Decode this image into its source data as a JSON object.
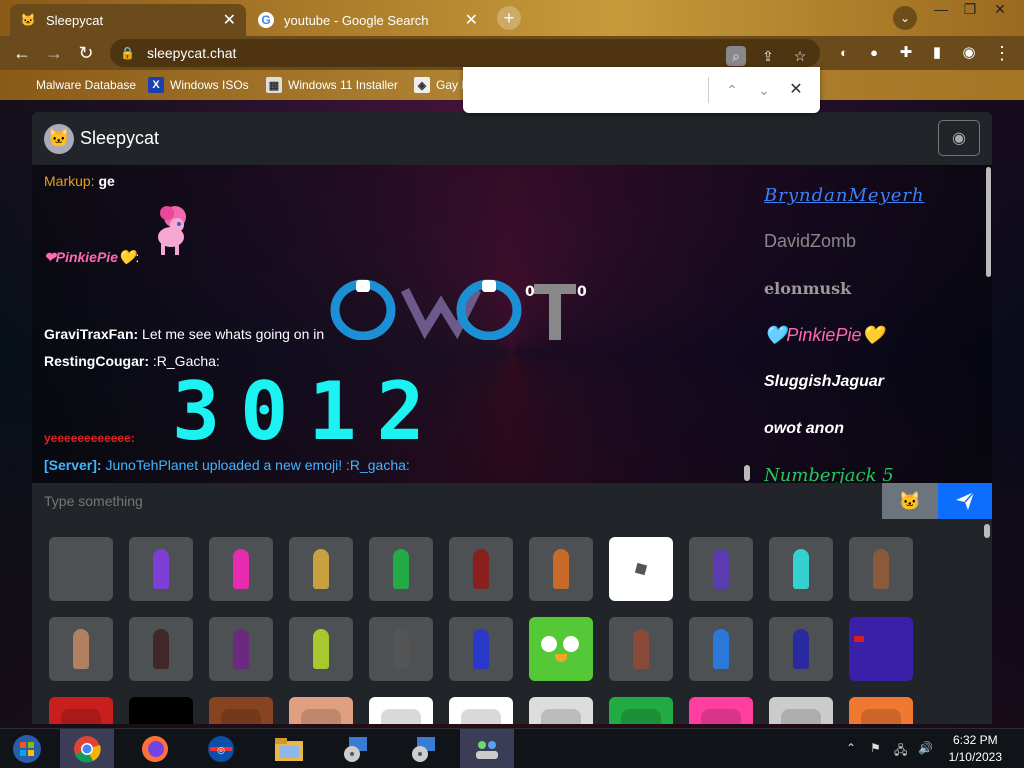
{
  "browser": {
    "tabs": [
      {
        "title": "Sleepycat",
        "active": true
      },
      {
        "title": "youtube - Google Search",
        "active": false
      }
    ],
    "new_tab_label": "+",
    "url": "sleepycat.chat",
    "bookmarks": [
      {
        "label": "Malware Database",
        "icon": "malware-icon"
      },
      {
        "label": "Windows ISOs",
        "icon": "x-logo-icon"
      },
      {
        "label": "Windows 11 Installer",
        "icon": "installer-icon"
      },
      {
        "label": "Gay F",
        "icon": "app-icon"
      }
    ],
    "find": {
      "value": ""
    }
  },
  "app": {
    "brand": "Sleepycat",
    "messages": [
      {
        "user": "Markup:",
        "text": " ge",
        "user_color": "#e0a020"
      },
      {
        "user": "❤PinkiePie💛",
        "text": ":",
        "user_color": "#ff69b4"
      },
      {
        "user": "GraviTraxFan:",
        "text": " Let me see whats going on in",
        "user_color": "#ffffff"
      },
      {
        "user": "RestingCougar:",
        "text": " :R_Gacha:",
        "user_color": "#ffffff"
      },
      {
        "user": "yeeeeeeeeeeee:",
        "text": "",
        "user_color": "#e02020"
      },
      {
        "user": "[Server]:",
        "text": " JunoTehPlanet uploaded a new emoji! :R_gacha:",
        "user_color": "#3fb6ff"
      }
    ],
    "owot_text": "OWOT",
    "owot_badges": [
      "0",
      "0"
    ],
    "big_digits": "3012",
    "users": [
      {
        "name": "BryndanMeyerh",
        "color": "#3b82f6"
      },
      {
        "name": "DavidZomb",
        "color": "#888888"
      },
      {
        "name": "elonmusk",
        "color": "#999999"
      },
      {
        "name": "🩵PinkiePie💛",
        "color": "#ff69b4"
      },
      {
        "name": "SluggishJaguar",
        "color": "#ffffff"
      },
      {
        "name": "owot anon",
        "color": "#ffffff"
      },
      {
        "name": "Numberjack 5",
        "color": "#22c55e"
      }
    ],
    "input_placeholder": "Type something"
  },
  "taskbar": {
    "time": "6:32 PM",
    "date": "1/10/2023"
  }
}
